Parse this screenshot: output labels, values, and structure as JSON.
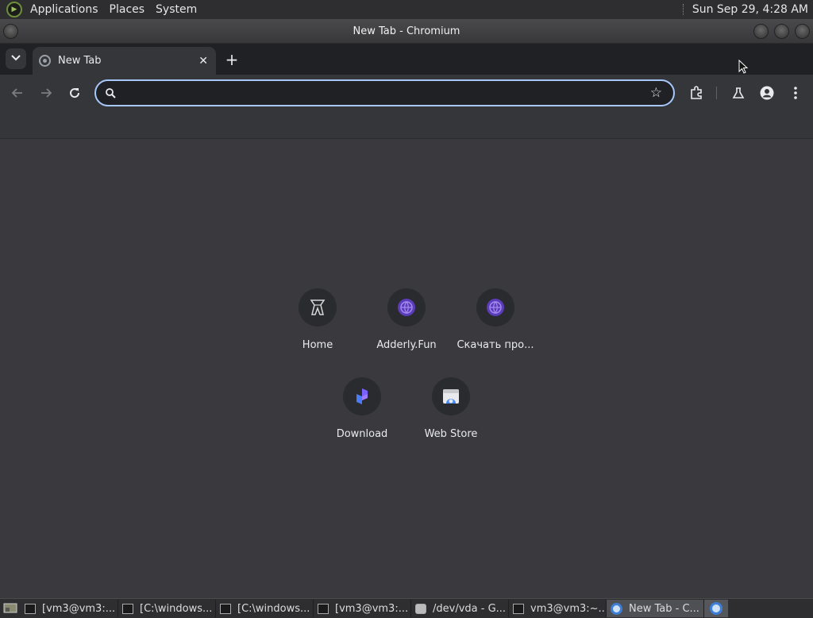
{
  "top_panel": {
    "menus": [
      "Applications",
      "Places",
      "System"
    ],
    "clock": "Sun Sep 29,  4:28 AM"
  },
  "window": {
    "title": "New Tab - Chromium"
  },
  "tabs": [
    {
      "label": "New Tab",
      "icon": "globe-icon",
      "active": true
    }
  ],
  "omnibox": {
    "value": "",
    "placeholder": ""
  },
  "shortcuts": [
    {
      "label": "Home",
      "icon": "castle-icon"
    },
    {
      "label": "Adderly.Fun",
      "icon": "purple-globe-icon"
    },
    {
      "label": "Скачать про...",
      "icon": "purple-globe-icon"
    },
    {
      "label": "Download",
      "icon": "download-site-icon"
    },
    {
      "label": "Web Store",
      "icon": "web-store-icon"
    }
  ],
  "taskbar": {
    "items": [
      {
        "label": "[vm3@vm3:...",
        "icon": "terminal-icon"
      },
      {
        "label": "[C:\\windows...",
        "icon": "terminal-icon"
      },
      {
        "label": "[C:\\windows...",
        "icon": "terminal-icon"
      },
      {
        "label": "[vm3@vm3:...",
        "icon": "terminal-icon"
      },
      {
        "label": "/dev/vda - G...",
        "icon": "disk-icon"
      },
      {
        "label": "vm3@vm3:~...",
        "icon": "terminal-icon"
      },
      {
        "label": "New Tab - C...",
        "icon": "chromium-icon",
        "active": true
      }
    ]
  },
  "colors": {
    "accent_focus_ring": "#a8c7fa",
    "content_bg": "#3a3a3e",
    "toolbar_bg": "#35363a",
    "tabstrip_bg": "#202124"
  }
}
